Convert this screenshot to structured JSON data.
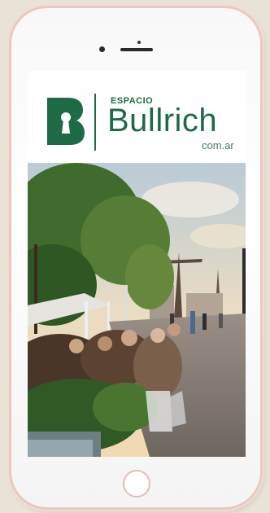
{
  "header": {
    "espacio_label": "ESPACIO",
    "brand_name": "Bullrich",
    "domain_label": "com.ar",
    "logo_letter": "B"
  },
  "colors": {
    "brand_green": "#1d6b44",
    "phone_frame": "#f8f8f8",
    "phone_trim": "#e8c9bf",
    "background": "#e9e2d6"
  },
  "icons": {
    "logo": "keyhole-b-logo-icon",
    "home": "home-button-icon"
  },
  "photo": {
    "scene": "waterfront-cafe-photo"
  }
}
